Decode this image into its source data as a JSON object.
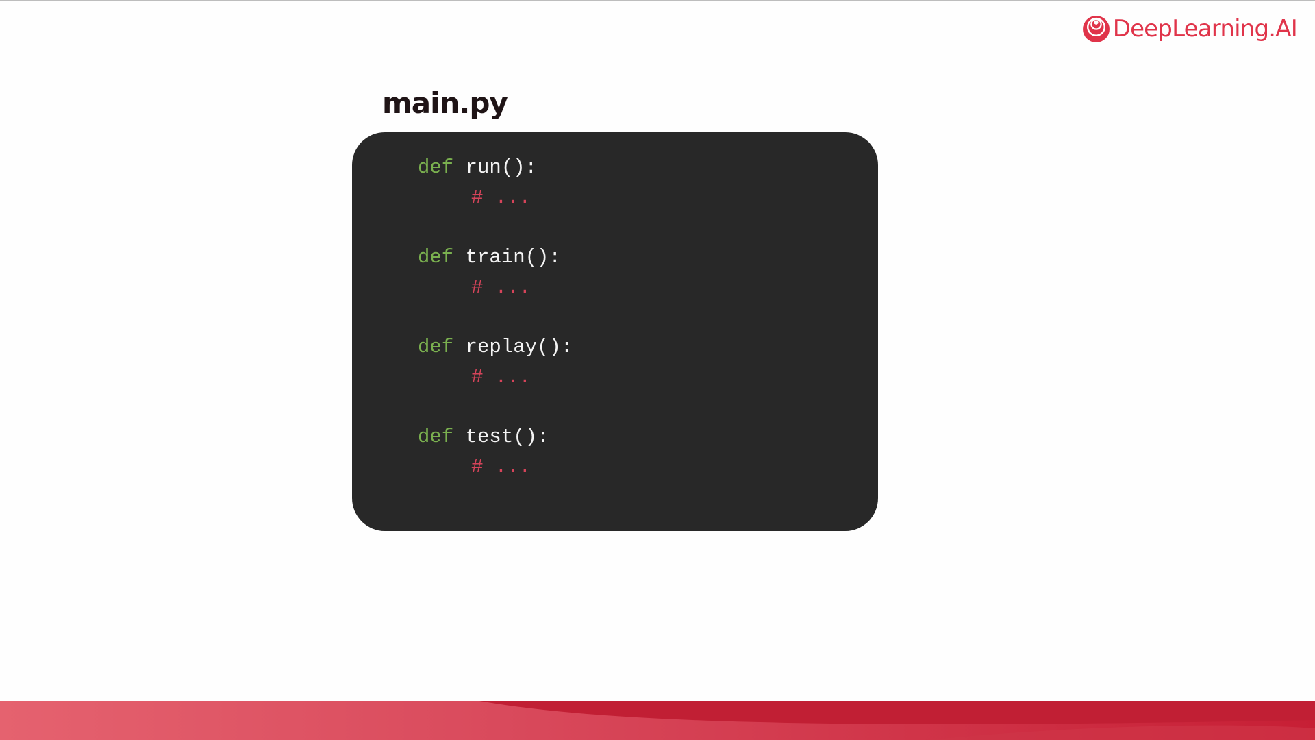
{
  "brand": {
    "logo_text": "DeepLearning.AI",
    "logo_icon": "deeplearning-ai-logo-icon",
    "accent_color": "#e0344a",
    "band_color": "#c11f34"
  },
  "slide": {
    "title": "main.py"
  },
  "code": {
    "background": "#282828",
    "keyword_color": "#7ab04f",
    "comment_color": "#d6445a",
    "blocks": [
      {
        "keyword": "def",
        "signature": "run():",
        "comment": "# ..."
      },
      {
        "keyword": "def",
        "signature": "train():",
        "comment": "# ..."
      },
      {
        "keyword": "def",
        "signature": "replay():",
        "comment": "# ..."
      },
      {
        "keyword": "def",
        "signature": "test():",
        "comment": "# ..."
      }
    ]
  }
}
